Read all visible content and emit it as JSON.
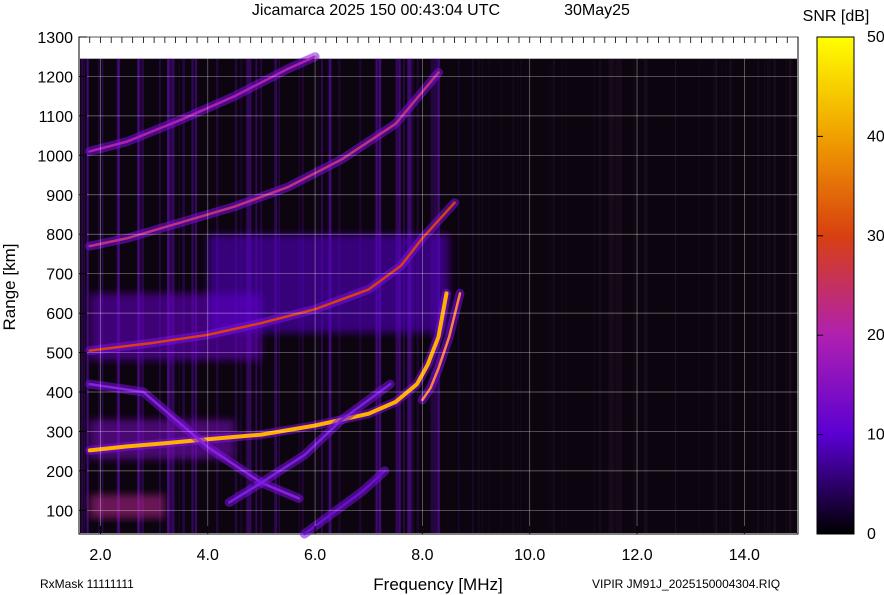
{
  "chart_data": {
    "type": "heatmap",
    "title": "Jicamarca 2025 150 00:43:04 UTC",
    "date_label": "30May25",
    "xlabel": "Frequency [MHz]",
    "ylabel": "Range [km]",
    "xlim": [
      1.6,
      15.0
    ],
    "ylim": [
      40,
      1300
    ],
    "x_ticks": [
      "2.0",
      "4.0",
      "6.0",
      "8.0",
      "10.0",
      "12.0",
      "14.0"
    ],
    "y_ticks": [
      "100",
      "200",
      "300",
      "400",
      "500",
      "600",
      "700",
      "800",
      "900",
      "1000",
      "1100",
      "1200",
      "1300"
    ],
    "colorbar": {
      "label": "SNR [dB]",
      "min": 0,
      "max": 50,
      "ticks": [
        "0",
        "10",
        "20",
        "30",
        "40",
        "50"
      ],
      "colors": [
        "#000000",
        "#5a00d2",
        "#b020b0",
        "#d84010",
        "#f0a000",
        "#ffff00"
      ]
    },
    "grid": true,
    "traces": [
      {
        "x": [
          1.8,
          2.5,
          3.2,
          4.0,
          5.0,
          6.0,
          7.0,
          7.5,
          7.9,
          8.1,
          8.3,
          8.45
        ],
        "y": [
          252,
          262,
          270,
          280,
          292,
          315,
          345,
          375,
          420,
          470,
          540,
          650
        ]
      },
      {
        "x": [
          8.0,
          8.15,
          8.3,
          8.5,
          8.7
        ],
        "y": [
          380,
          410,
          460,
          540,
          650
        ]
      },
      {
        "x": [
          1.8,
          3.0,
          4.0,
          5.0,
          6.0,
          7.0,
          7.6,
          8.0,
          8.6
        ],
        "y": [
          505,
          525,
          545,
          575,
          610,
          660,
          720,
          790,
          880
        ]
      },
      {
        "x": [
          1.8,
          2.5,
          3.5,
          4.5,
          5.5,
          6.5,
          7.5,
          8.3
        ],
        "y": [
          770,
          790,
          830,
          870,
          920,
          990,
          1080,
          1210
        ]
      },
      {
        "x": [
          1.8,
          2.5,
          3.5,
          4.5,
          5.5,
          6.0
        ],
        "y": [
          1010,
          1035,
          1090,
          1150,
          1220,
          1250
        ]
      },
      {
        "x": [
          1.8,
          2.8,
          4.0,
          5.0,
          5.7
        ],
        "y": [
          420,
          400,
          260,
          170,
          130
        ]
      },
      {
        "x": [
          4.4,
          5.0,
          5.8,
          6.5,
          7.4
        ],
        "y": [
          120,
          170,
          240,
          330,
          420
        ]
      },
      {
        "x": [
          5.8,
          6.3,
          6.9,
          7.3
        ],
        "y": [
          40,
          90,
          150,
          200
        ]
      }
    ],
    "blobs": [
      {
        "x": [
          1.8,
          3.2
        ],
        "y": [
          80,
          140
        ],
        "level": 22
      },
      {
        "x": [
          1.8,
          4.5
        ],
        "y": [
          230,
          330
        ],
        "level": 14
      },
      {
        "x": [
          1.8,
          5.0
        ],
        "y": [
          480,
          650
        ],
        "level": 12
      },
      {
        "x": [
          4.0,
          8.5
        ],
        "y": [
          550,
          800
        ],
        "level": 10
      }
    ]
  },
  "footer": {
    "rxmask": "RxMask 11111111",
    "file": "VIPIR  JM91J_2025150004304.RIQ"
  }
}
